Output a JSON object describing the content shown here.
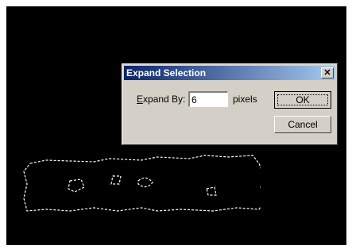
{
  "dialog": {
    "title": "Expand Selection",
    "expand_label_mnemonic": "E",
    "expand_label_rest": "xpand By:",
    "expand_value": "6",
    "unit_label": "pixels",
    "ok_label": "OK",
    "cancel_label": "Cancel",
    "close_glyph": "✕"
  },
  "colors": {
    "canvas": "#000000",
    "dialog_face": "#d4d0c8",
    "titlebar_start": "#0a246a",
    "titlebar_end": "#a6caf0",
    "marching_ants": "#ffffff"
  }
}
